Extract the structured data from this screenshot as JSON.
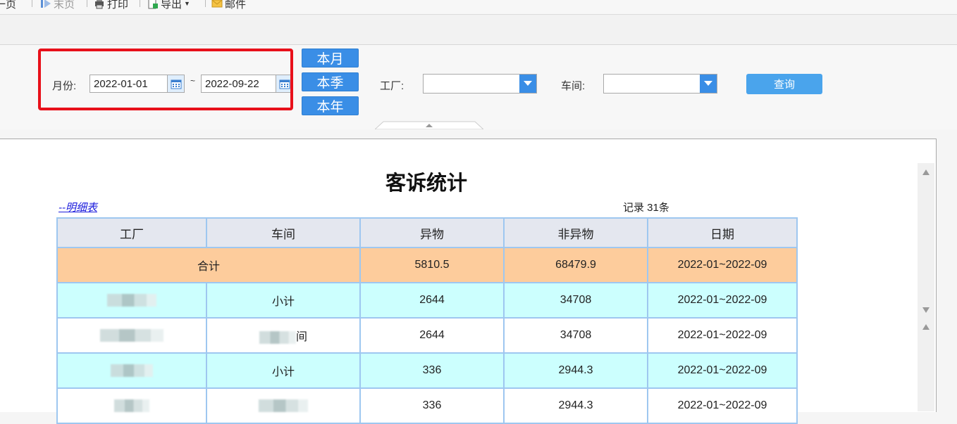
{
  "toolbar": {
    "prev_page": "上一页",
    "last_page": "末页",
    "print": "打印",
    "export": "导出",
    "mail": "邮件"
  },
  "filters": {
    "month_label": "月份:",
    "date_from": "2022-01-01",
    "range_sep": "~",
    "date_to": "2022-09-22",
    "quick_month": "本月",
    "quick_quarter": "本季",
    "quick_year": "本年",
    "factory_label": "工厂:",
    "factory_value": "",
    "workshop_label": "车间:",
    "workshop_value": "",
    "search_button": "查询"
  },
  "report": {
    "title": "客诉统计",
    "detail_link": "--明细表",
    "record_count": "记录 31条",
    "columns": [
      "工厂",
      "车间",
      "异物",
      "非异物",
      "日期"
    ],
    "total": {
      "label": "合计",
      "foreign": "5810.5",
      "non_foreign": "68479.9",
      "date": "2022-01~2022-09"
    },
    "rows": [
      {
        "type": "subtotal",
        "factory": "",
        "workshop": "小计",
        "foreign": "2644",
        "non_foreign": "34708",
        "date": "2022-01~2022-09"
      },
      {
        "type": "detail",
        "factory": "",
        "workshop": "间",
        "foreign": "2644",
        "non_foreign": "34708",
        "date": "2022-01~2022-09"
      },
      {
        "type": "subtotal",
        "factory": "",
        "workshop": "小计",
        "foreign": "336",
        "non_foreign": "2944.3",
        "date": "2022-01~2022-09"
      },
      {
        "type": "detail",
        "factory": "",
        "workshop": "",
        "foreign": "336",
        "non_foreign": "2944.3",
        "date": "2022-01~2022-09"
      }
    ]
  },
  "colors": {
    "accent": "#3a8ee6",
    "highlight": "#e8101a",
    "total_row": "#fdcc9c",
    "subtotal_row": "#ccfffe",
    "header_row": "#e4e7ef",
    "link": "#1a1adc"
  },
  "icons": {
    "prev": "play-left-icon",
    "last": "play-right-icon",
    "print": "printer-icon",
    "export": "export-icon",
    "mail": "mail-icon",
    "calendar": "calendar-icon",
    "dropdown": "chevron-down-icon"
  }
}
